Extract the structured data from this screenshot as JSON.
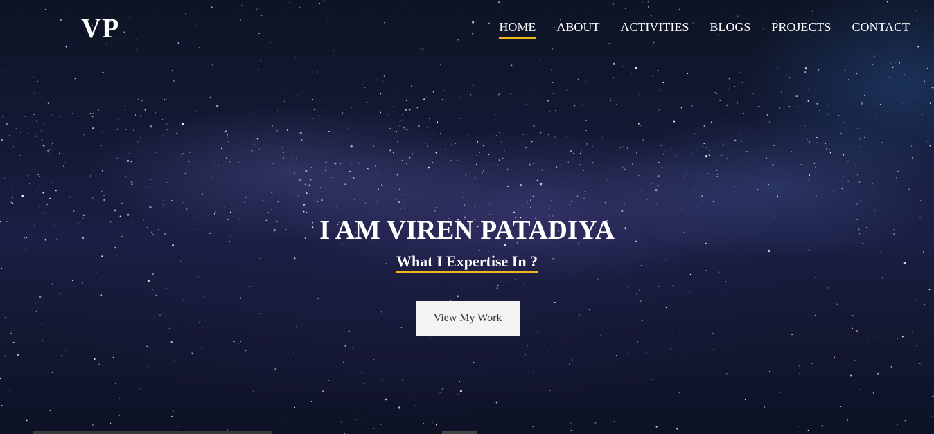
{
  "brand": {
    "logo": "VP"
  },
  "nav": {
    "items": [
      {
        "label": "HOME",
        "active": true
      },
      {
        "label": "ABOUT",
        "active": false
      },
      {
        "label": "ACTIVITIES",
        "active": false
      },
      {
        "label": "BLOGS",
        "active": false
      },
      {
        "label": "PROJECTS",
        "active": false
      },
      {
        "label": "CONTACT",
        "active": false
      }
    ]
  },
  "hero": {
    "title": "I AM VIREN PATADIYA",
    "subtitle": "What I Expertise In ?",
    "cta_label": "View My Work"
  },
  "colors": {
    "accent": "#f2b61a",
    "text": "#ffffff",
    "button_bg": "#f3f3f3",
    "button_text": "#333333"
  }
}
